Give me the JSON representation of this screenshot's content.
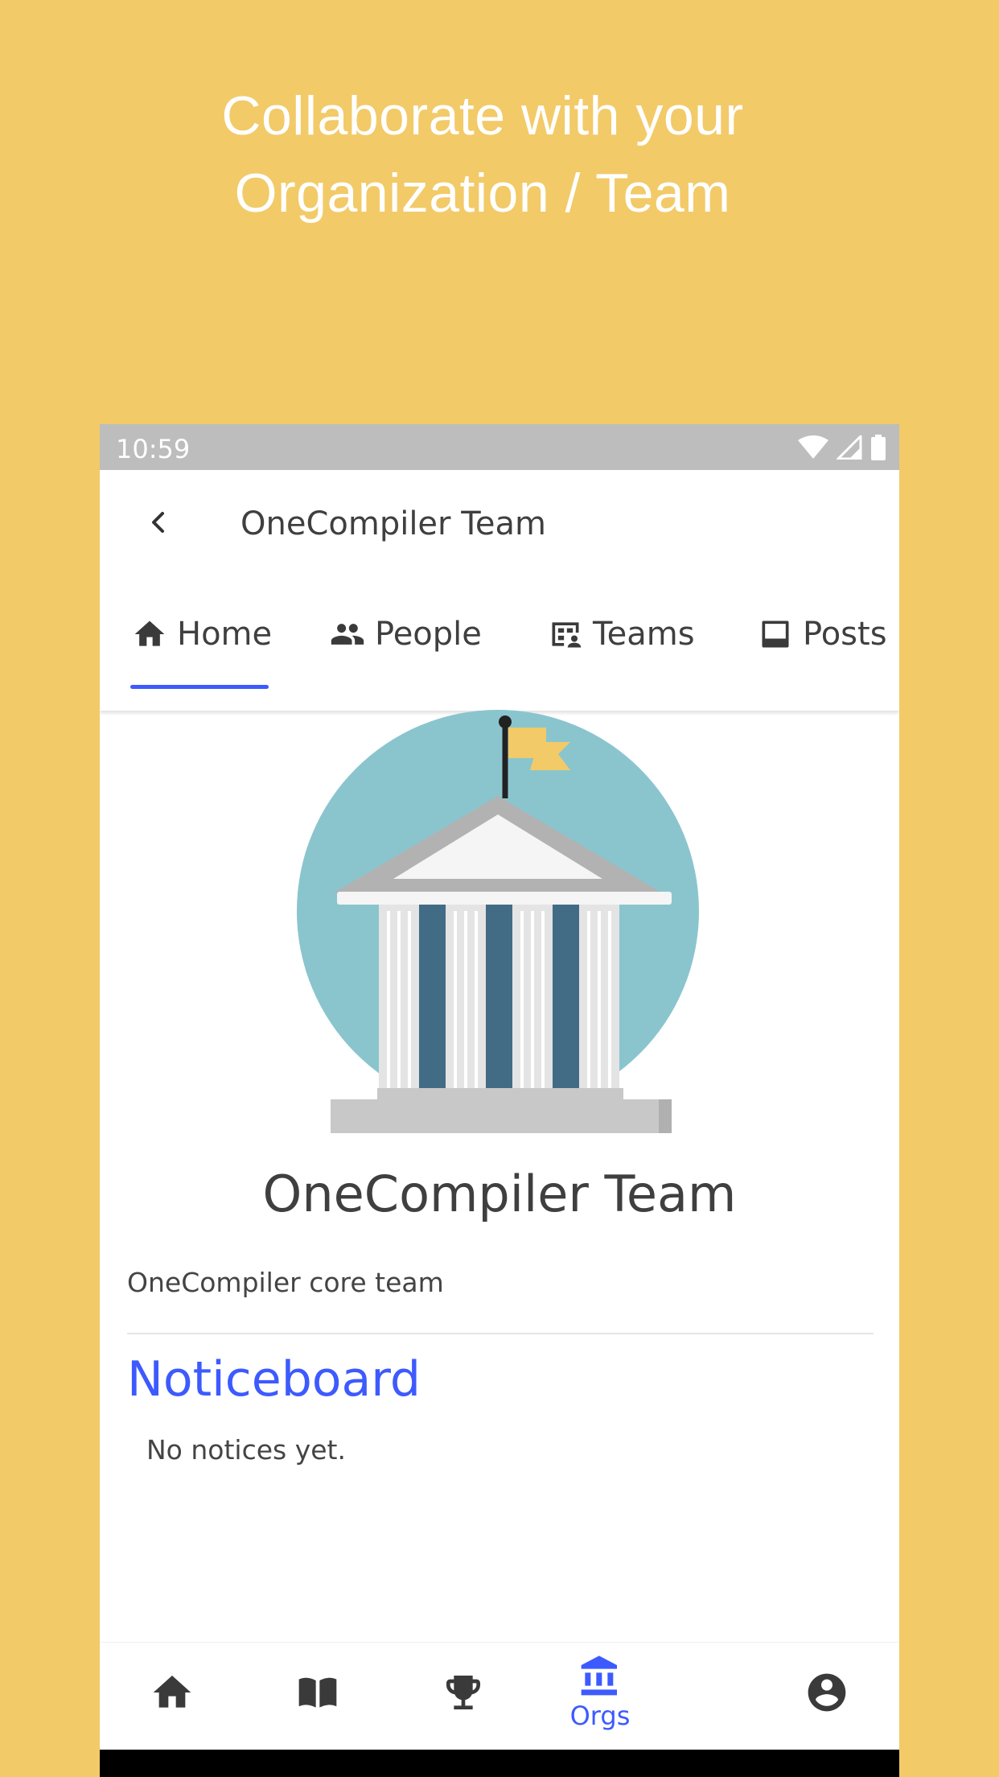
{
  "promo": {
    "line1": "Collaborate with your",
    "line2": "Organization / Team"
  },
  "status_bar": {
    "time": "10:59"
  },
  "app_bar": {
    "title": "OneCompiler Team"
  },
  "tabs": [
    {
      "label": "Home",
      "icon": "home-icon",
      "active": true
    },
    {
      "label": "People",
      "icon": "people-icon"
    },
    {
      "label": "Teams",
      "icon": "teams-icon"
    },
    {
      "label": "Posts",
      "icon": "posts-icon"
    }
  ],
  "org": {
    "name": "OneCompiler Team",
    "description": "OneCompiler core team"
  },
  "noticeboard": {
    "title": "Noticeboard",
    "empty_text": "No notices yet."
  },
  "bottom_nav": [
    {
      "icon": "home-icon",
      "label": ""
    },
    {
      "icon": "book-icon",
      "label": ""
    },
    {
      "icon": "trophy-icon",
      "label": ""
    },
    {
      "icon": "bank-icon",
      "label": "Orgs",
      "active": true
    },
    {
      "icon": "account-icon",
      "label": ""
    }
  ],
  "colors": {
    "background": "#F2CA68",
    "accent": "#3D5AFE",
    "status_bar": "#BDBDBD"
  }
}
